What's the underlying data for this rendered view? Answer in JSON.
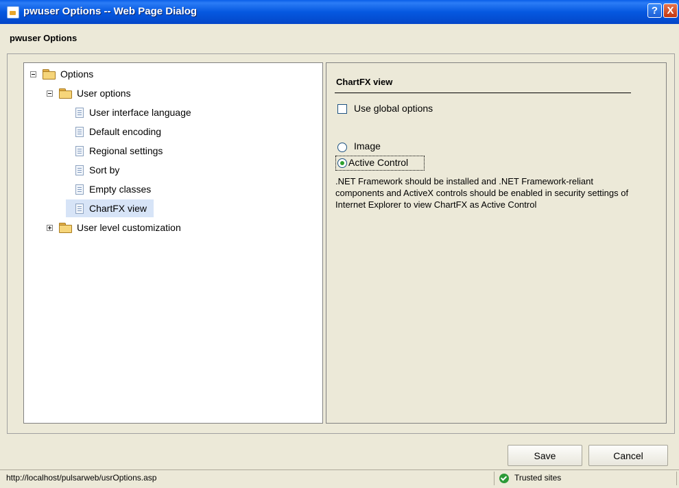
{
  "window": {
    "title": "pwuser Options -- Web Page Dialog",
    "help_glyph": "?",
    "close_glyph": "X",
    "icon": "ie-page-icon"
  },
  "dialog": {
    "heading": "pwuser Options"
  },
  "tree": {
    "root": {
      "label": "Options",
      "expanded": true
    },
    "user_options": {
      "label": "User options",
      "expanded": true,
      "children": [
        {
          "label": "User interface language"
        },
        {
          "label": "Default encoding"
        },
        {
          "label": "Regional settings"
        },
        {
          "label": "Sort by"
        },
        {
          "label": "Empty classes"
        },
        {
          "label": "ChartFX view",
          "selected": true
        }
      ]
    },
    "user_level": {
      "label": "User level customization",
      "expanded": false
    }
  },
  "settings": {
    "title": "ChartFX view",
    "use_global": {
      "label": "Use global options",
      "checked": false
    },
    "radios": [
      {
        "label": "Image",
        "checked": false
      },
      {
        "label": "Active Control",
        "checked": true
      }
    ],
    "info": ".NET Framework should be installed and .NET Framework-reliant components and ActiveX controls should be enabled in security settings of Internet Explorer to view ChartFX as Active Control"
  },
  "buttons": {
    "save": "Save",
    "cancel": "Cancel"
  },
  "status": {
    "url": "http://localhost/pulsarweb/usrOptions.asp",
    "zone": "Trusted sites"
  },
  "colors": {
    "titlebar": "#0558e0",
    "face": "#ece9d8",
    "selected_row": "#d7e4f7",
    "radio_dot": "#2ea02e"
  }
}
